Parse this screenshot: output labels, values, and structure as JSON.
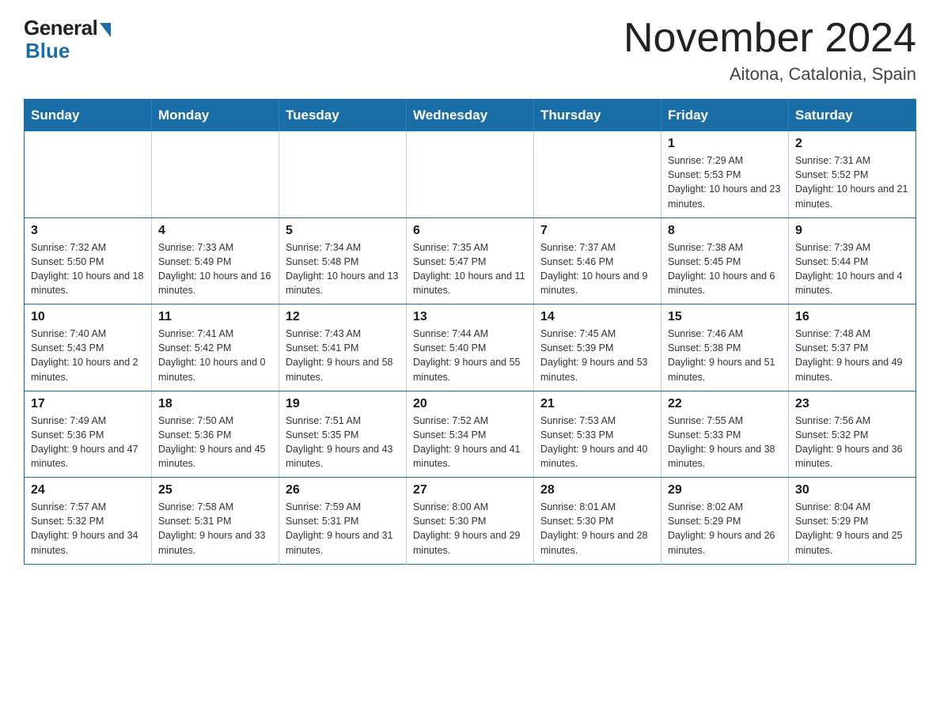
{
  "header": {
    "logo_general": "General",
    "logo_blue": "Blue",
    "month_title": "November 2024",
    "location": "Aitona, Catalonia, Spain"
  },
  "days_of_week": [
    "Sunday",
    "Monday",
    "Tuesday",
    "Wednesday",
    "Thursday",
    "Friday",
    "Saturday"
  ],
  "weeks": [
    [
      {
        "day": "",
        "info": ""
      },
      {
        "day": "",
        "info": ""
      },
      {
        "day": "",
        "info": ""
      },
      {
        "day": "",
        "info": ""
      },
      {
        "day": "",
        "info": ""
      },
      {
        "day": "1",
        "info": "Sunrise: 7:29 AM\nSunset: 5:53 PM\nDaylight: 10 hours and 23 minutes."
      },
      {
        "day": "2",
        "info": "Sunrise: 7:31 AM\nSunset: 5:52 PM\nDaylight: 10 hours and 21 minutes."
      }
    ],
    [
      {
        "day": "3",
        "info": "Sunrise: 7:32 AM\nSunset: 5:50 PM\nDaylight: 10 hours and 18 minutes."
      },
      {
        "day": "4",
        "info": "Sunrise: 7:33 AM\nSunset: 5:49 PM\nDaylight: 10 hours and 16 minutes."
      },
      {
        "day": "5",
        "info": "Sunrise: 7:34 AM\nSunset: 5:48 PM\nDaylight: 10 hours and 13 minutes."
      },
      {
        "day": "6",
        "info": "Sunrise: 7:35 AM\nSunset: 5:47 PM\nDaylight: 10 hours and 11 minutes."
      },
      {
        "day": "7",
        "info": "Sunrise: 7:37 AM\nSunset: 5:46 PM\nDaylight: 10 hours and 9 minutes."
      },
      {
        "day": "8",
        "info": "Sunrise: 7:38 AM\nSunset: 5:45 PM\nDaylight: 10 hours and 6 minutes."
      },
      {
        "day": "9",
        "info": "Sunrise: 7:39 AM\nSunset: 5:44 PM\nDaylight: 10 hours and 4 minutes."
      }
    ],
    [
      {
        "day": "10",
        "info": "Sunrise: 7:40 AM\nSunset: 5:43 PM\nDaylight: 10 hours and 2 minutes."
      },
      {
        "day": "11",
        "info": "Sunrise: 7:41 AM\nSunset: 5:42 PM\nDaylight: 10 hours and 0 minutes."
      },
      {
        "day": "12",
        "info": "Sunrise: 7:43 AM\nSunset: 5:41 PM\nDaylight: 9 hours and 58 minutes."
      },
      {
        "day": "13",
        "info": "Sunrise: 7:44 AM\nSunset: 5:40 PM\nDaylight: 9 hours and 55 minutes."
      },
      {
        "day": "14",
        "info": "Sunrise: 7:45 AM\nSunset: 5:39 PM\nDaylight: 9 hours and 53 minutes."
      },
      {
        "day": "15",
        "info": "Sunrise: 7:46 AM\nSunset: 5:38 PM\nDaylight: 9 hours and 51 minutes."
      },
      {
        "day": "16",
        "info": "Sunrise: 7:48 AM\nSunset: 5:37 PM\nDaylight: 9 hours and 49 minutes."
      }
    ],
    [
      {
        "day": "17",
        "info": "Sunrise: 7:49 AM\nSunset: 5:36 PM\nDaylight: 9 hours and 47 minutes."
      },
      {
        "day": "18",
        "info": "Sunrise: 7:50 AM\nSunset: 5:36 PM\nDaylight: 9 hours and 45 minutes."
      },
      {
        "day": "19",
        "info": "Sunrise: 7:51 AM\nSunset: 5:35 PM\nDaylight: 9 hours and 43 minutes."
      },
      {
        "day": "20",
        "info": "Sunrise: 7:52 AM\nSunset: 5:34 PM\nDaylight: 9 hours and 41 minutes."
      },
      {
        "day": "21",
        "info": "Sunrise: 7:53 AM\nSunset: 5:33 PM\nDaylight: 9 hours and 40 minutes."
      },
      {
        "day": "22",
        "info": "Sunrise: 7:55 AM\nSunset: 5:33 PM\nDaylight: 9 hours and 38 minutes."
      },
      {
        "day": "23",
        "info": "Sunrise: 7:56 AM\nSunset: 5:32 PM\nDaylight: 9 hours and 36 minutes."
      }
    ],
    [
      {
        "day": "24",
        "info": "Sunrise: 7:57 AM\nSunset: 5:32 PM\nDaylight: 9 hours and 34 minutes."
      },
      {
        "day": "25",
        "info": "Sunrise: 7:58 AM\nSunset: 5:31 PM\nDaylight: 9 hours and 33 minutes."
      },
      {
        "day": "26",
        "info": "Sunrise: 7:59 AM\nSunset: 5:31 PM\nDaylight: 9 hours and 31 minutes."
      },
      {
        "day": "27",
        "info": "Sunrise: 8:00 AM\nSunset: 5:30 PM\nDaylight: 9 hours and 29 minutes."
      },
      {
        "day": "28",
        "info": "Sunrise: 8:01 AM\nSunset: 5:30 PM\nDaylight: 9 hours and 28 minutes."
      },
      {
        "day": "29",
        "info": "Sunrise: 8:02 AM\nSunset: 5:29 PM\nDaylight: 9 hours and 26 minutes."
      },
      {
        "day": "30",
        "info": "Sunrise: 8:04 AM\nSunset: 5:29 PM\nDaylight: 9 hours and 25 minutes."
      }
    ]
  ]
}
